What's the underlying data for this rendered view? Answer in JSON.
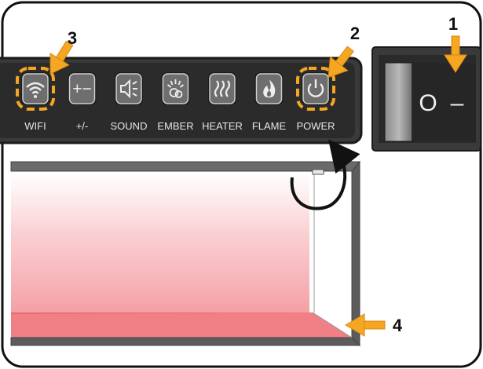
{
  "control_panel": {
    "buttons": [
      {
        "label": "WIFI",
        "icon": "wifi-icon"
      },
      {
        "label": "+/-",
        "icon": "plus-minus-icon",
        "glyph": "+−"
      },
      {
        "label": "SOUND",
        "icon": "speaker-icon"
      },
      {
        "label": "EMBER",
        "icon": "ember-icon"
      },
      {
        "label": "HEATER",
        "icon": "heat-waves-icon"
      },
      {
        "label": "FLAME",
        "icon": "flame-icon"
      },
      {
        "label": "POWER",
        "icon": "power-icon"
      }
    ]
  },
  "rocker_switch": {
    "off_symbol": "O",
    "on_symbol": "–"
  },
  "callouts": {
    "one": "1",
    "two": "2",
    "three": "3",
    "four": "4"
  },
  "colors": {
    "panel": "#2b2b2b",
    "button_face": "#6e6e6e",
    "highlight_ring": "#f5a623",
    "arrow": "#f5a623",
    "ember_bed": "#f07f86",
    "frame": "#5c5c5c"
  }
}
